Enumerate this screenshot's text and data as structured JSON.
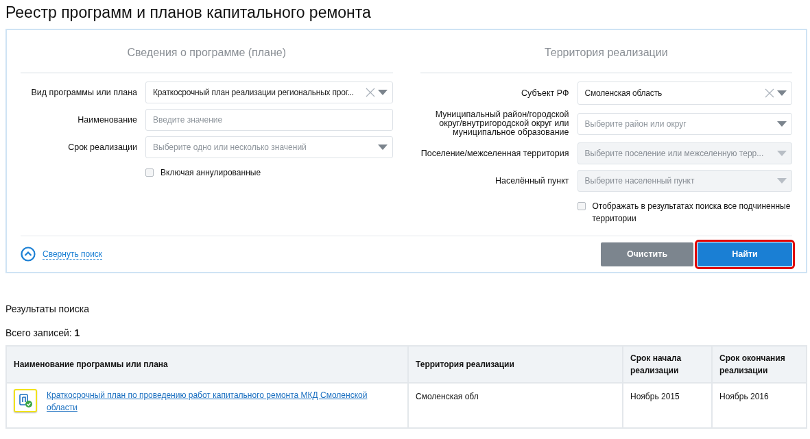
{
  "page_title": "Реестр программ и планов капитального ремонта",
  "search_panel": {
    "sections": [
      {
        "title": "Сведения о программе (плане)",
        "fields": [
          {
            "label": "Вид программы или плана",
            "kind": "select",
            "value": "Краткосрочный план реализации региональных прог...",
            "clearable": true,
            "disabled": false
          },
          {
            "label": "Наименование",
            "kind": "text",
            "placeholder": "Введите значение",
            "clearable": false,
            "disabled": false
          },
          {
            "label": "Срок реализации",
            "kind": "select",
            "placeholder": "Выберите одно или несколько значений",
            "clearable": false,
            "disabled": false
          }
        ],
        "checkbox": {
          "label": "Включая аннулированные",
          "checked": false
        }
      },
      {
        "title": "Территория реализации",
        "fields": [
          {
            "label": "Субъект РФ",
            "kind": "select",
            "value": "Смоленская область",
            "clearable": true,
            "disabled": false
          },
          {
            "label": "Муниципальный район/городской округ/внутригородской округ или муниципальное образование",
            "kind": "select",
            "placeholder": "Выберите район или округ",
            "clearable": false,
            "disabled": false
          },
          {
            "label": "Поселение/межселенная территория",
            "kind": "select",
            "placeholder": "Выберите поселение или межселенную терр...",
            "clearable": false,
            "disabled": true
          },
          {
            "label": "Населённый пункт",
            "kind": "select",
            "placeholder": "Выберите населенный пункт",
            "clearable": false,
            "disabled": true
          }
        ],
        "checkbox": {
          "label": "Отображать в результатах поиска все подчиненные территории",
          "checked": false
        }
      }
    ],
    "collapse_link": "Свернуть поиск",
    "buttons": [
      {
        "label": "Очистить",
        "kind": "secondary",
        "highlighted": false
      },
      {
        "label": "Найти",
        "kind": "primary",
        "highlighted": true
      }
    ]
  },
  "results": {
    "title": "Результаты поиска",
    "total_label": "Всего записей:",
    "total": "1",
    "table": {
      "columns": [
        "Наименование программы или плана",
        "Территория реализации",
        "Срок начала реализации",
        "Срок окончания реализации"
      ],
      "rows": [
        {
          "cells": [
            {
              "kind": "link",
              "text": "Краткосрочный план по проведению работ капитального ремонта МКД Смоленской области"
            },
            {
              "kind": "text",
              "text": "Смоленская обл"
            },
            {
              "kind": "text",
              "text": "Ноябрь 2015"
            },
            {
              "kind": "text",
              "text": "Ноябрь 2016"
            }
          ]
        }
      ]
    }
  }
}
